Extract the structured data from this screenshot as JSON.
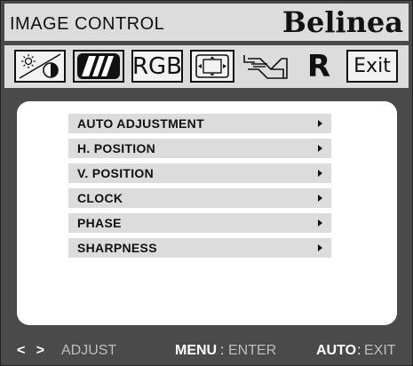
{
  "header": {
    "title": "IMAGE CONTROL",
    "brand": "Belinea"
  },
  "toolbar": {
    "items": [
      {
        "icon": "brightness-contrast-icon"
      },
      {
        "icon": "image-control-icon",
        "active": true
      },
      {
        "icon": "color-rgb-icon",
        "label": "RGB"
      },
      {
        "icon": "position-icon"
      },
      {
        "icon": "osd-settings-icon"
      },
      {
        "icon": "reset-icon",
        "label": "R"
      },
      {
        "icon": "exit-icon",
        "label": "Exit"
      }
    ]
  },
  "menu": {
    "items": [
      {
        "label": "AUTO ADJUSTMENT"
      },
      {
        "label": "H. POSITION"
      },
      {
        "label": "V. POSITION"
      },
      {
        "label": "CLOCK"
      },
      {
        "label": "PHASE"
      },
      {
        "label": "SHARPNESS"
      }
    ]
  },
  "footer": {
    "arrows": "< >",
    "adjust": "ADJUST",
    "menu_key": "MENU",
    "menu_sep": ":",
    "menu_action": "ENTER",
    "auto_key": "AUTO",
    "auto_sep": ":",
    "auto_action": "EXIT"
  },
  "colors": {
    "bezel": "#4a4a4a",
    "bar": "#dcdcdc",
    "panel": "#ffffff",
    "text": "#111111"
  }
}
